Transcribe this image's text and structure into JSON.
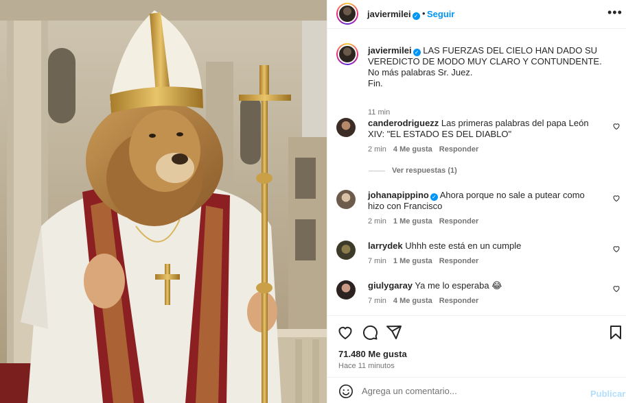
{
  "post": {
    "username": "javiermilei",
    "follow_label": "Seguir",
    "more_label": "•••"
  },
  "caption": {
    "username": "javiermilei",
    "lines": [
      "LAS FUERZAS DEL CIELO HAN DADO SU VEREDICTO DE MODO MUY CLARO Y CONTUNDENTE.",
      "No más palabras Sr. Juez.",
      "Fin."
    ],
    "time": "11 min"
  },
  "comments": [
    {
      "username": "canderodriguezz",
      "text": "Las primeras palabras del papa León XIV: \"EL ESTADO ES DEL DIABLO\"",
      "time": "2 min",
      "likes": "4 Me gusta",
      "reply": "Responder",
      "verified": false
    },
    {
      "username": "johanapippino",
      "text": "Ahora porque no sale a putear como hizo con Francisco",
      "time": "2 min",
      "likes": "1 Me gusta",
      "reply": "Responder",
      "verified": true
    },
    {
      "username": "larrydek",
      "text": "Uhhh este está en un cumple",
      "time": "7 min",
      "likes": "1 Me gusta",
      "reply": "Responder",
      "verified": false
    },
    {
      "username": "giulygaray",
      "text": "Ya me lo esperaba 😂",
      "time": "7 min",
      "likes": "4 Me gusta",
      "reply": "Responder",
      "verified": false
    }
  ],
  "view_replies": "Ver respuestas (1)",
  "likes_count": "71.480 Me gusta",
  "posted_ago": "Hace 11 minutos",
  "add_comment": {
    "placeholder": "Agrega un comentario...",
    "post_label": "Publicar"
  },
  "icons": [
    "heart-icon",
    "comment-icon",
    "share-icon",
    "save-icon",
    "emoji-icon",
    "more-icon",
    "verified-badge-icon"
  ],
  "colors": {
    "accent": "#0095f6",
    "muted": "#737373",
    "text": "#262626",
    "publish_disabled": "#b2dffc"
  }
}
